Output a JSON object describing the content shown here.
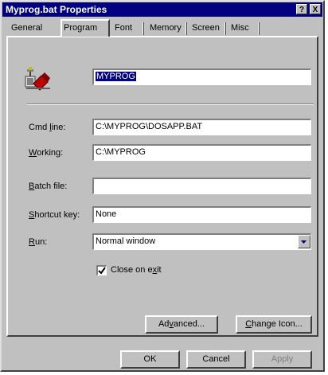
{
  "window": {
    "title": "Myprog.bat Properties",
    "help_label": "?",
    "close_label": "X"
  },
  "tabs": [
    {
      "label": "General"
    },
    {
      "label": "Program"
    },
    {
      "label": "Font"
    },
    {
      "label": "Memory"
    },
    {
      "label": "Screen"
    },
    {
      "label": "Misc"
    }
  ],
  "program": {
    "icon_name": "dos-program-icon",
    "name_value": "MYPROG",
    "cmd_line": {
      "label": "Cmd line:",
      "value": "C:\\MYPROG\\DOSAPP.BAT"
    },
    "working": {
      "label": "Working:",
      "value": "C:\\MYPROG"
    },
    "batch_file": {
      "label": "Batch file:",
      "value": ""
    },
    "shortcut_key": {
      "label": "Shortcut key:",
      "value": "None"
    },
    "run": {
      "label": "Run:",
      "value": "Normal window"
    },
    "close_on_exit": {
      "label": "Close on exit",
      "checked": true
    },
    "advanced_label": "Advanced...",
    "change_icon_label": "Change Icon..."
  },
  "footer": {
    "ok_label": "OK",
    "cancel_label": "Cancel",
    "apply_label": "Apply"
  },
  "colors": {
    "titlebar": "#000080",
    "face": "#c0c0c0",
    "selection": "#000080"
  }
}
